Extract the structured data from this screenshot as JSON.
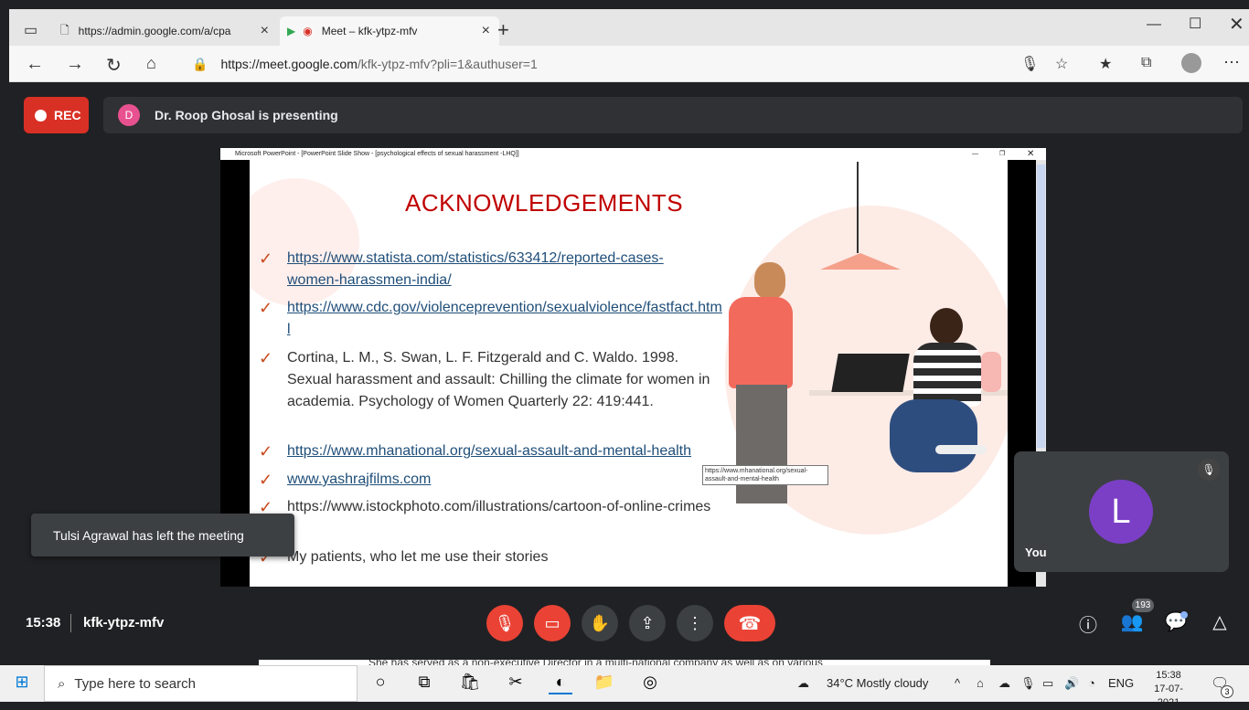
{
  "browser": {
    "tabs": [
      {
        "label": "https://admin.google.com/a/cpa",
        "active": false
      },
      {
        "label": "Meet – kfk-ytpz-mfv",
        "active": true
      }
    ],
    "url": "https://meet.google.com/kfk-ytpz-mfv?pli=1&authuser=1",
    "url_host": "https://meet.google.com",
    "url_path": "/kfk-ytpz-mfv?pli=1&authuser=1"
  },
  "meet": {
    "rec_label": "REC",
    "presenter_initial": "D",
    "presenting_text": "Dr. Roop Ghosal is presenting",
    "toast": "Tulsi Agrawal has left the meeting",
    "self_initial": "L",
    "self_label": "You",
    "time": "15:38",
    "meeting_code": "kfk-ytpz-mfv",
    "participants_count": "193",
    "colors": {
      "rec": "#d93025",
      "end_call": "#ea4335",
      "bg": "#202124",
      "avatar_self": "#7b3fc6",
      "avatar_presenter": "#e8518f"
    }
  },
  "slide": {
    "window_title": "Microsoft PowerPoint - [PowerPoint Slide Show - [psychological effects of sexual harassment -LHQ]]",
    "title": "ACKNOWLEDGEMENTS",
    "items": [
      {
        "text": "https://www.statista.com/statistics/633412/reported-cases-women-harassmen-india/",
        "link": true
      },
      {
        "text": "https://www.cdc.gov/violenceprevention/sexualviolence/fastfact.html",
        "link": true
      },
      {
        "text": "Cortina, L. M., S. Swan, L. F. Fitzgerald and C. Waldo. 1998. Sexual harassment and assault: Chilling the climate for women in academia. Psychology of Women Quarterly 22: 419:441.",
        "link": false
      },
      {
        "text": "https://www.mhanational.org/sexual-assault-and-mental-health",
        "link": true
      },
      {
        "text": "www.yashrajfilms.com",
        "link": true
      },
      {
        "text": " https://www.istockphoto.com/illustrations/cartoon-of-online-crimes",
        "link": false
      },
      {
        "text": "My patients, who let me use their stories",
        "link": false
      }
    ],
    "tooltip": "https://www.mhanational.org/sexual-assault-and-mental-health"
  },
  "underlying_text": "She has served as a non-executive Director in a multi-national company as well as on various",
  "taskbar": {
    "search_placeholder": "Type here to search",
    "weather": "34°C  Mostly cloudy",
    "lang": "ENG",
    "time": "15:38",
    "date": "17-07-2021",
    "notif_count": "3"
  }
}
